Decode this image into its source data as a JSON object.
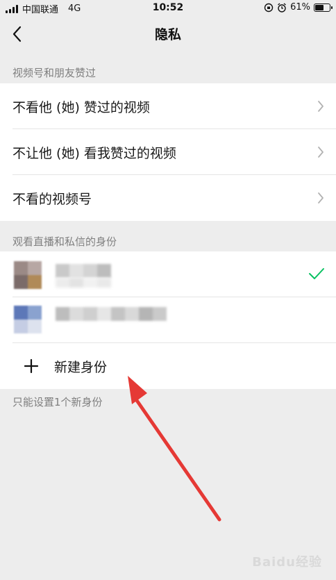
{
  "status_bar": {
    "carrier": "中国联通",
    "network": "4G",
    "time": "10:52",
    "battery_percent": "61%",
    "battery_level": 0.61
  },
  "nav": {
    "title": "隐私",
    "back_icon": "chevron-left-icon"
  },
  "section_likes": {
    "header": "视频号和朋友赞过",
    "items": [
      {
        "label": "不看他 (她) 赞过的视频",
        "icon": "chevron-right-icon"
      },
      {
        "label": "不让他 (她) 看我赞过的视频",
        "icon": "chevron-right-icon"
      },
      {
        "label": "不看的视频号",
        "icon": "chevron-right-icon"
      }
    ]
  },
  "section_identity": {
    "header": "观看直播和私信的身份",
    "identities": [
      {
        "avatar_colors": [
          "#9b8a86",
          "#b7a7a3",
          "#7b6b69",
          "#b08a58"
        ],
        "selected": true
      },
      {
        "avatar_colors": [
          "#5d78b8",
          "#8aa2cf",
          "#c5cde4",
          "#dde2ee"
        ],
        "selected": false
      }
    ],
    "add_label": "新建身份",
    "footer_note": "只能设置1个新身份"
  },
  "colors": {
    "accent_green": "#07c160",
    "annotation_red": "#e53935",
    "background": "#ededed"
  },
  "watermark": "Baidu经验"
}
